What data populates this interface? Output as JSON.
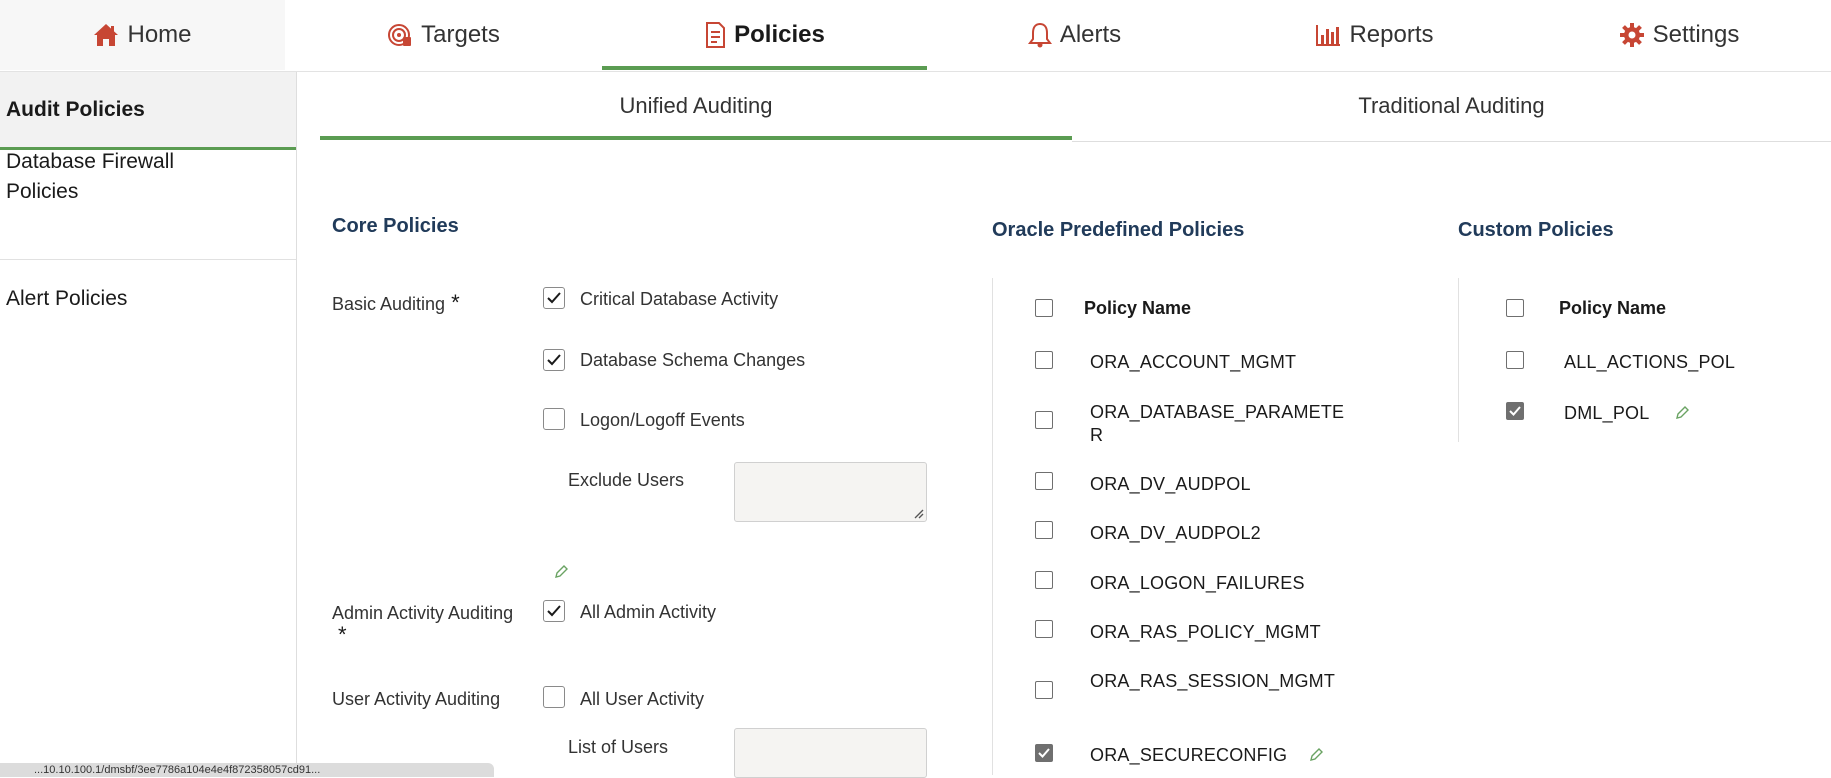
{
  "nav": {
    "tabs": [
      {
        "label": "Home",
        "icon": "home-icon"
      },
      {
        "label": "Targets",
        "icon": "target-icon"
      },
      {
        "label": "Policies",
        "icon": "policy-document-icon",
        "active": true
      },
      {
        "label": "Alerts",
        "icon": "bell-icon"
      },
      {
        "label": "Reports",
        "icon": "bar-chart-icon"
      },
      {
        "label": "Settings",
        "icon": "gear-icon"
      }
    ]
  },
  "sidebar": {
    "items": [
      {
        "label": "Audit Policies",
        "active": true
      },
      {
        "label": "Database Firewall Policies"
      },
      {
        "label": "Alert Policies"
      }
    ]
  },
  "subtabs": [
    {
      "label": "Unified Auditing",
      "active": true
    },
    {
      "label": "Traditional Auditing"
    }
  ],
  "core": {
    "title": "Core Policies",
    "basic_label": "Basic Auditing",
    "required_mark": "*",
    "basic_options": [
      {
        "label": "Critical Database Activity",
        "checked": true
      },
      {
        "label": "Database Schema Changes",
        "checked": true
      },
      {
        "label": "Logon/Logoff Events",
        "checked": false
      }
    ],
    "exclude_users_label": "Exclude Users",
    "admin_label": "Admin Activity Auditing",
    "admin_option": {
      "label": "All Admin Activity",
      "checked": true
    },
    "user_label": "User Activity Auditing",
    "user_option": {
      "label": "All User Activity",
      "checked": false
    },
    "list_users_label": "List of Users"
  },
  "oracle": {
    "title": "Oracle Predefined Policies",
    "column_header": "Policy Name",
    "policies": [
      {
        "name": "ORA_ACCOUNT_MGMT",
        "checked": false
      },
      {
        "name": "ORA_DATABASE_PARAMETE",
        "name_line2": "R",
        "checked": false
      },
      {
        "name": "ORA_DV_AUDPOL",
        "checked": false
      },
      {
        "name": "ORA_DV_AUDPOL2",
        "checked": false
      },
      {
        "name": "ORA_LOGON_FAILURES",
        "checked": false
      },
      {
        "name": "ORA_RAS_POLICY_MGMT",
        "checked": false
      },
      {
        "name": "ORA_RAS_SESSION_MGMT",
        "checked": false
      },
      {
        "name": "ORA_SECURECONFIG",
        "checked": true
      }
    ]
  },
  "custom": {
    "title": "Custom Policies",
    "column_header": "Policy Name",
    "policies": [
      {
        "name": "ALL_ACTIONS_POL",
        "checked": false
      },
      {
        "name": "DML_POL",
        "checked": true
      }
    ]
  },
  "statusbar": {
    "text": "...10.10.100.1/dmsbf/3ee7786a104e4e4f872358057cd91..."
  },
  "colors": {
    "accent": "#5b9c52",
    "icon_red": "#c74634",
    "heading_blue": "#213b5a"
  }
}
